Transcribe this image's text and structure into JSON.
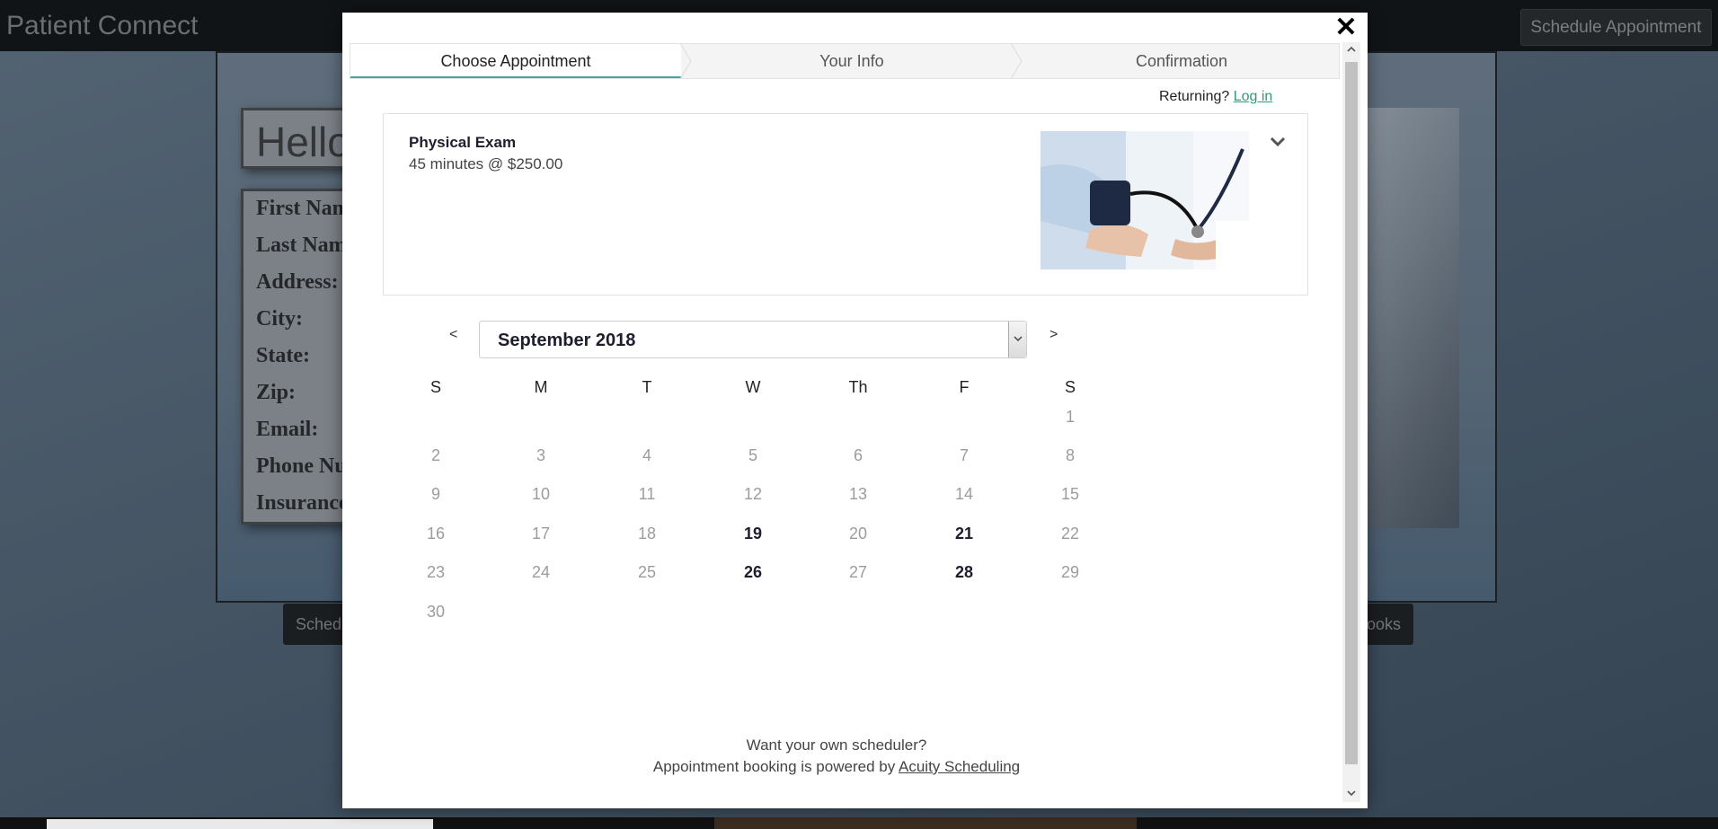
{
  "app": {
    "title": "Patient Connect",
    "top_button": "Schedule Appointment"
  },
  "background_page": {
    "hello_text": "Hello",
    "form_labels": [
      "First Name:",
      "Last Name:",
      "Address:",
      "City:",
      "State:",
      "Zip:",
      "Email:",
      "Phone Number:",
      "Insurance:"
    ],
    "bottom_left_button": "Schedule",
    "bottom_right_button": "Books"
  },
  "modal": {
    "close_glyph": "✕",
    "steps": [
      {
        "label": "Choose Appointment",
        "active": true
      },
      {
        "label": "Your Info",
        "active": false
      },
      {
        "label": "Confirmation",
        "active": false
      }
    ],
    "returning_text": "Returning?",
    "login_link": "Log in",
    "appointment": {
      "title": "Physical Exam",
      "description": "45 minutes @ $250.00",
      "image_icon": "blood-pressure-exam-photo"
    },
    "calendar": {
      "prev_label": "<",
      "next_label": ">",
      "month": "September 2018",
      "weekdays": [
        "S",
        "M",
        "T",
        "W",
        "Th",
        "F",
        "S"
      ],
      "first_weekday_index": 6,
      "days_in_month": 30,
      "available_days": [
        19,
        21,
        26,
        28
      ]
    },
    "footer": {
      "line1": "Want your own scheduler?",
      "line2_prefix": "Appointment booking is powered by",
      "link": "Acuity Scheduling"
    }
  },
  "colors": {
    "accent": "#43a89b",
    "link": "#2f9a73",
    "available_day": "#1e1e2e",
    "unavailable_day": "#9c9c9c"
  }
}
